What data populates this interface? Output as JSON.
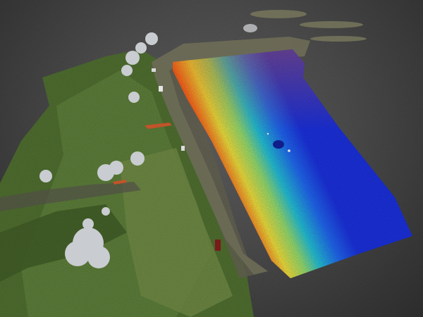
{
  "scene": {
    "background_top": "#5e5e5e",
    "background_bottom": "#2f2f2f",
    "colors": {
      "deep_blue": "#1a2fd6",
      "blue": "#1f64e8",
      "cyan": "#22b9cf",
      "yellow": "#e6d63a",
      "orange": "#f0641c",
      "red": "#d61e1e",
      "vegetation": "#4f6e30",
      "field": "#5d7a3c",
      "embankment": "#6b6a55",
      "tree": "#c9ccd0"
    }
  }
}
